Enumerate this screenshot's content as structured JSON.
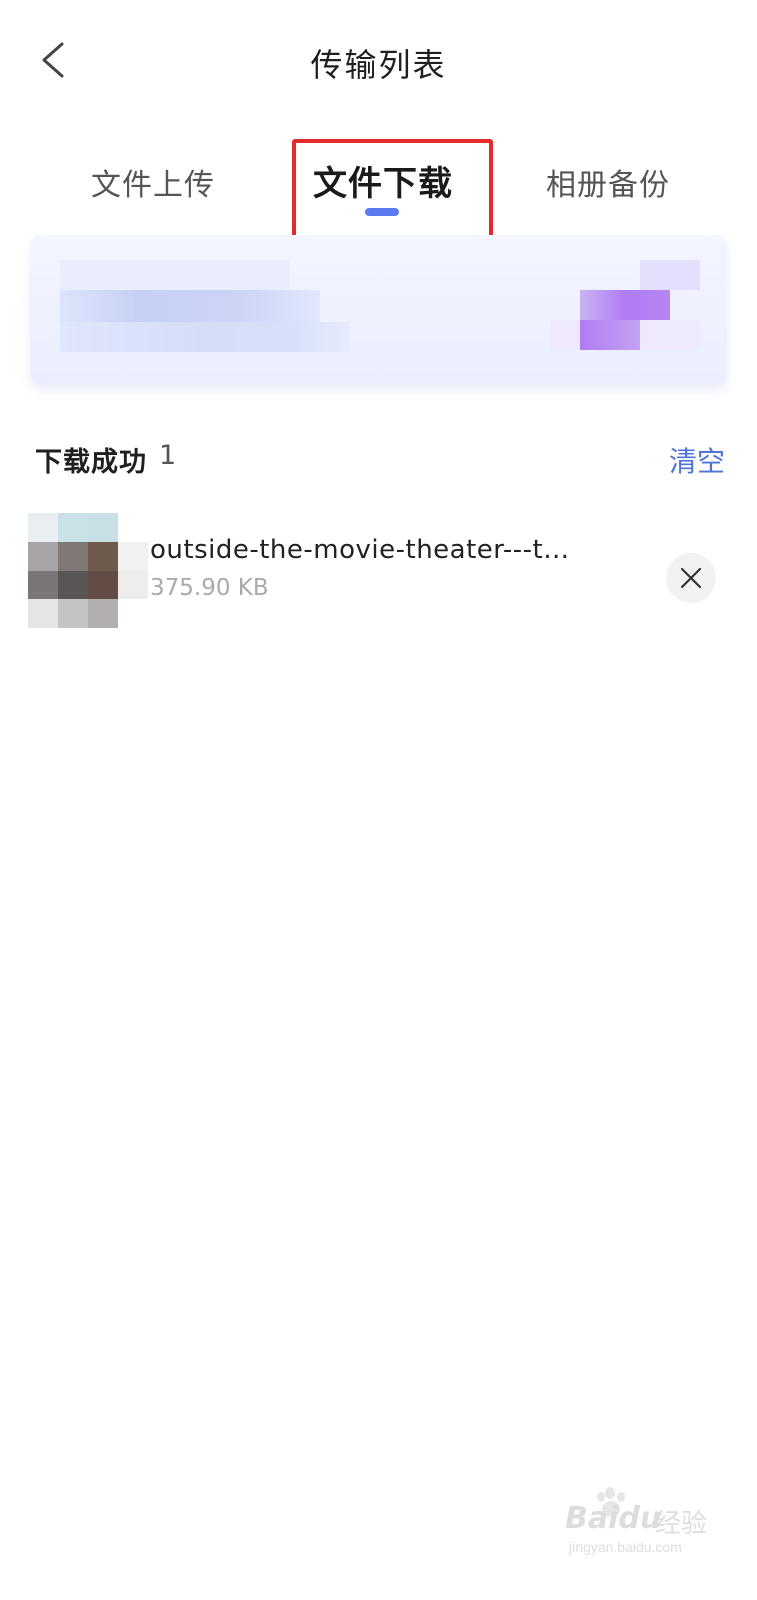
{
  "header": {
    "title": "传输列表",
    "back_icon": "chevron-left-icon"
  },
  "tabs": [
    {
      "label": "文件上传",
      "active": false
    },
    {
      "label": "文件下载",
      "active": true
    },
    {
      "label": "相册备份",
      "active": false
    }
  ],
  "accent_color": "#5a7cf0",
  "highlight_color": "#e52a2a",
  "section": {
    "title": "下载成功",
    "count": "1",
    "clear_label": "清空"
  },
  "files": [
    {
      "name": "outside-the-movie-theater---t…",
      "size": "375.90 KB",
      "remove_icon": "close-icon"
    }
  ],
  "watermark": {
    "brand": "Bai",
    "brand_suffix": "du",
    "brand_cn": "经验",
    "url": "jingyan.baidu.com"
  }
}
